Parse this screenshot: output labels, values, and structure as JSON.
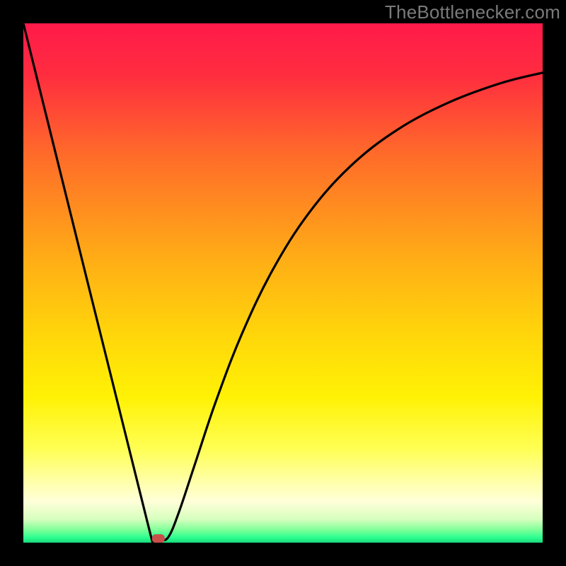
{
  "attribution": "TheBottlenecker.com",
  "chart_data": {
    "type": "line",
    "title": "",
    "xlabel": "",
    "ylabel": "",
    "xlim": [
      0,
      100
    ],
    "ylim": [
      0,
      100
    ],
    "background_gradient": {
      "stops": [
        {
          "offset": 0.0,
          "color": "#ff1a4a"
        },
        {
          "offset": 0.1,
          "color": "#ff2d3f"
        },
        {
          "offset": 0.25,
          "color": "#ff6a2a"
        },
        {
          "offset": 0.45,
          "color": "#ffac16"
        },
        {
          "offset": 0.6,
          "color": "#ffd60a"
        },
        {
          "offset": 0.72,
          "color": "#fff205"
        },
        {
          "offset": 0.82,
          "color": "#ffff55"
        },
        {
          "offset": 0.88,
          "color": "#ffffa6"
        },
        {
          "offset": 0.92,
          "color": "#ffffd9"
        },
        {
          "offset": 0.955,
          "color": "#d7ffbf"
        },
        {
          "offset": 0.975,
          "color": "#80ff99"
        },
        {
          "offset": 0.99,
          "color": "#2cff90"
        },
        {
          "offset": 1.0,
          "color": "#19d97a"
        }
      ]
    },
    "curve_points": [
      {
        "x": 0.0,
        "y": 100.0
      },
      {
        "x": 24.0,
        "y": 3.5
      },
      {
        "x": 25.0,
        "y": 0.8
      },
      {
        "x": 26.5,
        "y": 0.5
      },
      {
        "x": 28.0,
        "y": 1.2
      },
      {
        "x": 30.0,
        "y": 6.0
      },
      {
        "x": 33.0,
        "y": 15.0
      },
      {
        "x": 37.0,
        "y": 27.0
      },
      {
        "x": 42.0,
        "y": 40.0
      },
      {
        "x": 48.0,
        "y": 52.5
      },
      {
        "x": 55.0,
        "y": 63.5
      },
      {
        "x": 63.0,
        "y": 72.5
      },
      {
        "x": 72.0,
        "y": 79.5
      },
      {
        "x": 82.0,
        "y": 84.8
      },
      {
        "x": 92.0,
        "y": 88.5
      },
      {
        "x": 100.0,
        "y": 90.5
      }
    ],
    "marker": {
      "x": 26.0,
      "y": 0.8,
      "color": "#c94f4a"
    }
  }
}
